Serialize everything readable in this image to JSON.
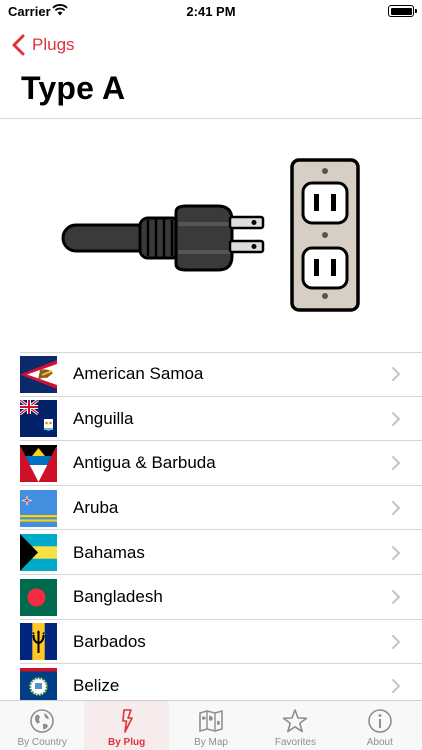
{
  "status_bar": {
    "carrier": "Carrier",
    "time": "2:41 PM"
  },
  "nav": {
    "back_label": "Plugs"
  },
  "page": {
    "title": "Type A"
  },
  "countries": [
    {
      "name": "American Samoa",
      "flag": "american-samoa"
    },
    {
      "name": "Anguilla",
      "flag": "anguilla"
    },
    {
      "name": "Antigua & Barbuda",
      "flag": "antigua-barbuda"
    },
    {
      "name": "Aruba",
      "flag": "aruba"
    },
    {
      "name": "Bahamas",
      "flag": "bahamas"
    },
    {
      "name": "Bangladesh",
      "flag": "bangladesh"
    },
    {
      "name": "Barbados",
      "flag": "barbados"
    },
    {
      "name": "Belize",
      "flag": "belize"
    }
  ],
  "tabs": [
    {
      "label": "By Country",
      "icon": "globe-icon",
      "active": false
    },
    {
      "label": "By Plug",
      "icon": "lightning-icon",
      "active": true
    },
    {
      "label": "By Map",
      "icon": "map-icon",
      "active": false
    },
    {
      "label": "Favorites",
      "icon": "star-icon",
      "active": false
    },
    {
      "label": "About",
      "icon": "info-icon",
      "active": false
    }
  ],
  "colors": {
    "accent": "#e0323c",
    "inactive": "#8e8e93",
    "divider": "#d6d6da"
  }
}
